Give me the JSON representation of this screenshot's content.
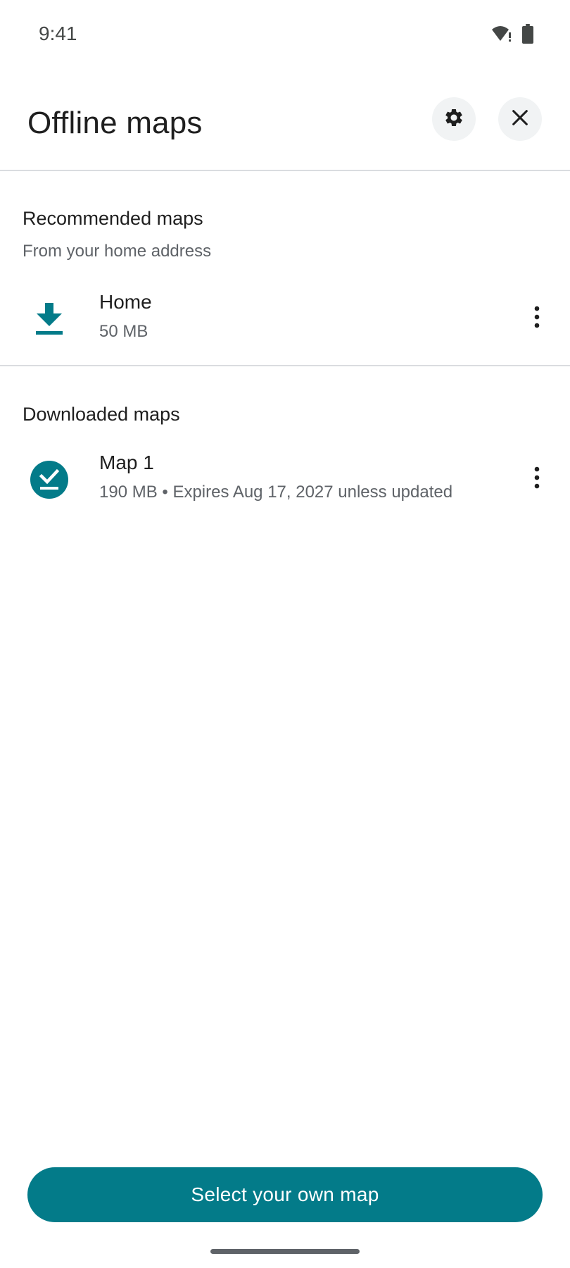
{
  "status_bar": {
    "time": "9:41",
    "icons": [
      "wifi-alert-icon",
      "battery-icon"
    ]
  },
  "header": {
    "title": "Offline maps",
    "settings_icon": "gear-icon",
    "close_icon": "close-icon"
  },
  "recommended": {
    "title": "Recommended maps",
    "subtitle": "From your home address",
    "items": [
      {
        "name": "Home",
        "detail": "50 MB",
        "icon": "download-icon"
      }
    ]
  },
  "downloaded": {
    "title": "Downloaded maps",
    "items": [
      {
        "name": "Map 1",
        "detail": "190 MB • Expires Aug 17, 2027 unless updated",
        "icon": "downloaded-check-icon"
      }
    ]
  },
  "footer": {
    "primary_button": "Select your own map"
  },
  "colors": {
    "accent": "#037b89",
    "text_primary": "#1f1f1f",
    "text_secondary": "#5f6368",
    "divider": "#dadce0",
    "icon_button_bg": "#f1f3f4"
  }
}
